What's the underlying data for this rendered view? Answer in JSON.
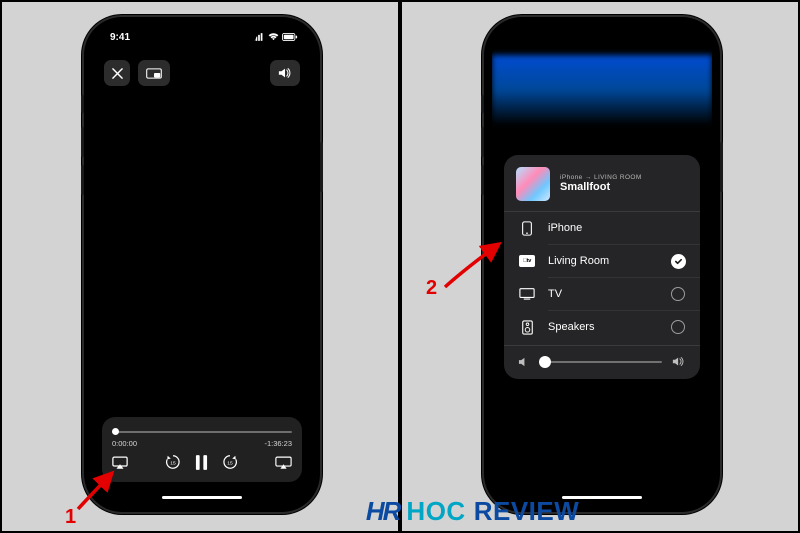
{
  "annotations": {
    "step1": "1",
    "step2": "2"
  },
  "watermark": {
    "hr": "HR",
    "hoc": "HOC",
    "review": "REVIEW"
  },
  "screen1": {
    "status": {
      "time": "9:41"
    },
    "player": {
      "elapsed": "0:00:00",
      "remaining": "-1:36:23"
    }
  },
  "screen2": {
    "now_playing": {
      "route": "iPhone → LIVING ROOM",
      "title": "Smallfoot"
    },
    "devices": [
      {
        "label": "iPhone",
        "icon": "iphone",
        "selected": false
      },
      {
        "label": "Living Room",
        "icon": "appletv",
        "selected": true
      },
      {
        "label": "TV",
        "icon": "tv",
        "selected": false
      },
      {
        "label": "Speakers",
        "icon": "speaker",
        "selected": false
      }
    ],
    "atv_badge": "tv"
  }
}
